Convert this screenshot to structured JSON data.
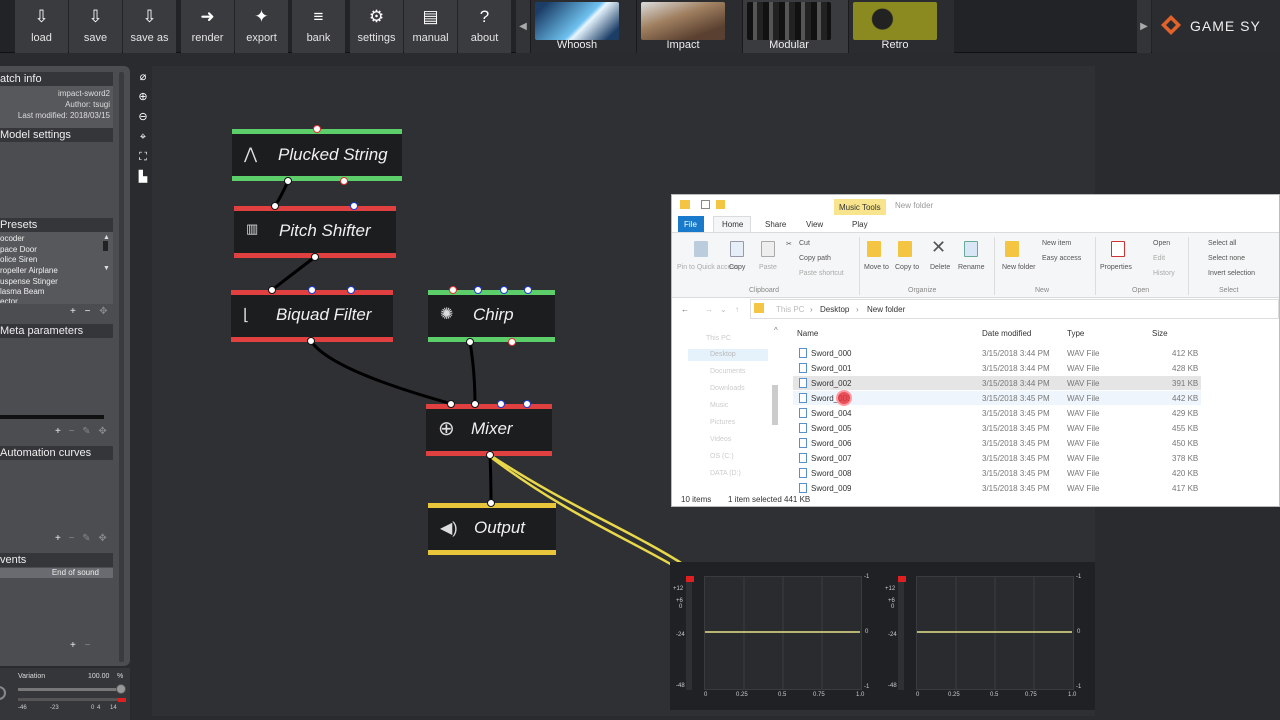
{
  "toolbar": {
    "buttons": [
      {
        "label": "load",
        "icon": "load-icon",
        "glyph": "⇩"
      },
      {
        "label": "save",
        "icon": "save-icon",
        "glyph": "⇩"
      },
      {
        "label": "save as",
        "icon": "save-as-icon",
        "glyph": "⇩"
      },
      {
        "label": "render",
        "icon": "render-icon",
        "glyph": "➜"
      },
      {
        "label": "export",
        "icon": "export-icon",
        "glyph": "✦"
      },
      {
        "label": "bank",
        "icon": "bank-icon",
        "glyph": "≡"
      },
      {
        "label": "settings",
        "icon": "gear-icon",
        "glyph": "⚙"
      },
      {
        "label": "manual",
        "icon": "manual-icon",
        "glyph": "▤"
      },
      {
        "label": "about",
        "icon": "about-icon",
        "glyph": "?"
      }
    ],
    "presets": [
      {
        "label": "Whoosh",
        "color": "#4aa6d8"
      },
      {
        "label": "Impact",
        "color": "#8a6a4a"
      },
      {
        "label": "Modular",
        "color": "#555"
      },
      {
        "label": "Retro",
        "color": "#8a8a20"
      }
    ],
    "brand": "GAME SY"
  },
  "left_panel": {
    "patch_info": {
      "title": "atch info",
      "name": "impact-sword2",
      "author": "Author: tsugi",
      "modified": "Last modified: 2018/03/15"
    },
    "model_settings": "Model settings",
    "presets": {
      "title": "Presets",
      "items": [
        "ocoder",
        "pace Door",
        "olice Siren",
        "ropeller Airplane",
        "uspense Stinger",
        "lasma Beam",
        "ector"
      ]
    },
    "meta_parameters": "Meta parameters",
    "automation_curves": "Automation curves",
    "events": {
      "title": "vents",
      "item": "End of sound"
    },
    "variation": {
      "label": "Variation",
      "value": "100.00",
      "unit": "%"
    },
    "scale": [
      "-46",
      "-23",
      "0",
      "4",
      "14"
    ]
  },
  "nodes": {
    "plucked": "Plucked String",
    "pitch": "Pitch Shifter",
    "biquad": "Biquad Filter",
    "chirp": "Chirp",
    "mixer": "Mixer",
    "output": "Output"
  },
  "explorer": {
    "tab_context": "Music Tools",
    "window_title": "New folder",
    "tabs": [
      "File",
      "Home",
      "Share",
      "View",
      "Play"
    ],
    "ribbon": {
      "pin": "Pin to Quick access",
      "copy": "Copy",
      "paste": "Paste",
      "cut": "Cut",
      "copy_path": "Copy path",
      "paste_shortcut": "Paste shortcut",
      "clipboard": "Clipboard",
      "move_to": "Move to",
      "copy_to": "Copy to",
      "delete": "Delete",
      "rename": "Rename",
      "organize": "Organize",
      "new_folder": "New folder",
      "new_item": "New item",
      "easy_access": "Easy access",
      "new": "New",
      "properties": "Properties",
      "open": "Open",
      "edit": "Edit",
      "history": "History",
      "open_group": "Open",
      "select_all": "Select all",
      "select_none": "Select none",
      "invert_selection": "Invert selection",
      "select": "Select"
    },
    "breadcrumb": [
      "This PC",
      "Desktop",
      "New folder"
    ],
    "nav": [
      "This PC",
      "Desktop",
      "Documents",
      "Downloads",
      "Music",
      "Pictures",
      "Videos",
      "OS (C:)",
      "DATA (D:)"
    ],
    "columns": [
      "Name",
      "Date modified",
      "Type",
      "Size"
    ],
    "files": [
      {
        "name": "Sword_000",
        "date": "3/15/2018 3:44 PM",
        "type": "WAV File",
        "size": "412 KB"
      },
      {
        "name": "Sword_001",
        "date": "3/15/2018 3:44 PM",
        "type": "WAV File",
        "size": "428 KB"
      },
      {
        "name": "Sword_002",
        "date": "3/15/2018 3:44 PM",
        "type": "WAV File",
        "size": "391 KB"
      },
      {
        "name": "Sword_003",
        "date": "3/15/2018 3:45 PM",
        "type": "WAV File",
        "size": "442 KB"
      },
      {
        "name": "Sword_004",
        "date": "3/15/2018 3:45 PM",
        "type": "WAV File",
        "size": "429 KB"
      },
      {
        "name": "Sword_005",
        "date": "3/15/2018 3:45 PM",
        "type": "WAV File",
        "size": "455 KB"
      },
      {
        "name": "Sword_006",
        "date": "3/15/2018 3:45 PM",
        "type": "WAV File",
        "size": "450 KB"
      },
      {
        "name": "Sword_007",
        "date": "3/15/2018 3:45 PM",
        "type": "WAV File",
        "size": "378 KB"
      },
      {
        "name": "Sword_008",
        "date": "3/15/2018 3:45 PM",
        "type": "WAV File",
        "size": "420 KB"
      },
      {
        "name": "Sword_009",
        "date": "3/15/2018 3:45 PM",
        "type": "WAV File",
        "size": "417 KB"
      }
    ],
    "status": {
      "count": "10 items",
      "selected": "1 item selected  441 KB"
    }
  },
  "meters": {
    "db_labels": [
      "+12",
      "+6",
      "0",
      "-24",
      "-48"
    ],
    "right_labels": [
      "-1",
      "0",
      "-1"
    ],
    "x_labels": [
      "0",
      "0.25",
      "0.5",
      "0.75",
      "1.0"
    ]
  }
}
